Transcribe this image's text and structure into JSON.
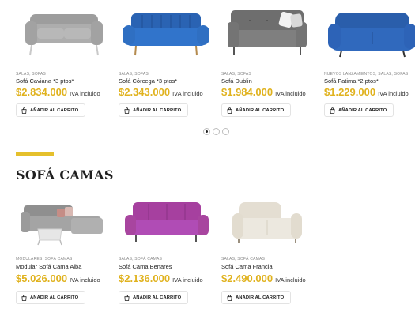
{
  "top_products": [
    {
      "category": "SALAS, SOFAS",
      "name": "Sofá Caviana *3 ptos*",
      "price": "$2.834.000",
      "iva": "IVA incluido",
      "button": "AÑADIR AL CARRITO",
      "color": "#a9a9a9"
    },
    {
      "category": "SALAS, SOFAS",
      "name": "Sofá Córcega *3 ptos*",
      "price": "$2.343.000",
      "iva": "IVA incluido",
      "button": "AÑADIR AL CARRITO",
      "color": "#2f6fc2"
    },
    {
      "category": "SALAS, SOFAS",
      "name": "Sofá Dublin",
      "price": "$1.984.000",
      "iva": "IVA incluido",
      "button": "AÑADIR AL CARRITO",
      "color": "#7c7c7c"
    },
    {
      "category": "NUEVOS LANZAMIENTOS, SALAS, SOFAS",
      "name": "Sofá Fatima *2 ptos*",
      "price": "$1.229.000",
      "iva": "IVA incluido",
      "button": "AÑADIR AL CARRITO",
      "color": "#2d63b7"
    }
  ],
  "carousel": {
    "pages": 3,
    "active": 0
  },
  "section": {
    "title": "SOFÁ CAMAS",
    "accent_color": "#e5c02c"
  },
  "bottom_products": [
    {
      "category": "MODULARES, SOFÁ CAMAS",
      "name": "Modular Sofá Cama Alba",
      "price": "$5.026.000",
      "iva": "IVA incluido",
      "button": "AÑADIR AL CARRITO",
      "color": "#a4a4a4"
    },
    {
      "category": "SALAS, SOFÁ CAMAS",
      "name": "Sofá Cama Benares",
      "price": "$2.136.000",
      "iva": "IVA incluido",
      "button": "AÑADIR AL CARRITO",
      "color": "#b04cb5"
    },
    {
      "category": "SALAS, SOFÁ CAMAS",
      "name": "Sofá Cama Francia",
      "price": "$2.490.000",
      "iva": "IVA incluido",
      "button": "AÑADIR AL CARRITO",
      "color": "#ece8df"
    }
  ],
  "theme": {
    "price_color": "#e0b21e"
  }
}
